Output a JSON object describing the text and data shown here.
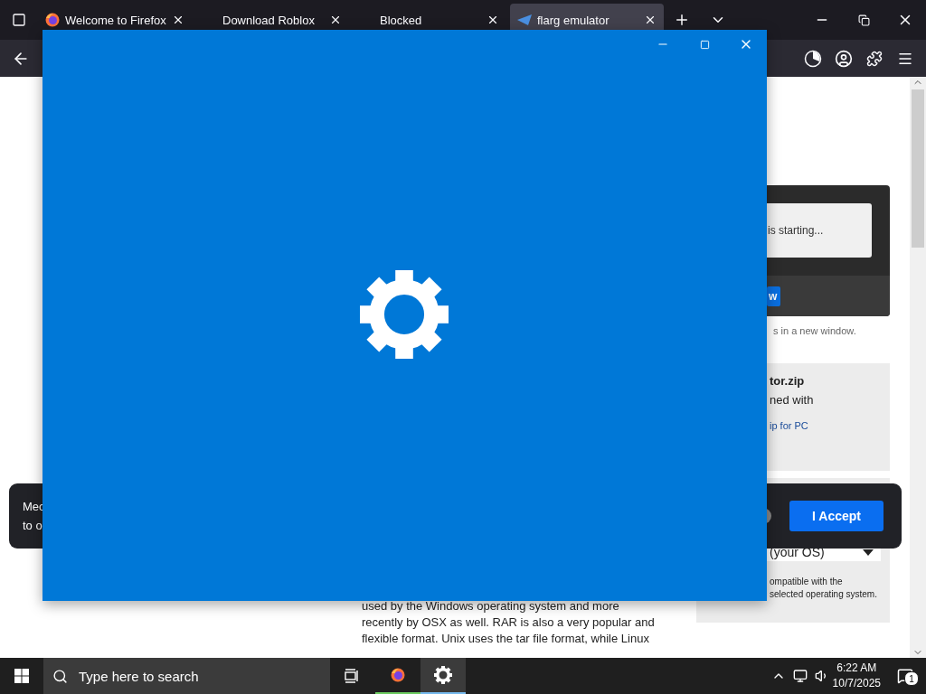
{
  "browser": {
    "tabs": [
      {
        "label": "Welcome to Firefox",
        "kind": "firefox",
        "selected": false
      },
      {
        "label": "Download Roblox",
        "kind": "plain",
        "selected": false
      },
      {
        "label": "Blocked",
        "kind": "plain",
        "selected": false
      },
      {
        "label": "flarg emulator",
        "kind": "app",
        "selected": true
      }
    ]
  },
  "page": {
    "status_text": "is starting...",
    "window_button": "w",
    "window_note": "s in a new window.",
    "file_card": {
      "filename": "tor.zip",
      "opened_with": "ned with",
      "link": "ip for PC"
    },
    "os_select": {
      "value": "(your OS)"
    },
    "compat_note": [
      "ompatible with the",
      "selected operating system."
    ],
    "article_lines": [
      "used by the Windows operating system and more",
      "recently by OSX as well. RAR is also a very popular and",
      "flexible format. Unix uses the tar file format, while Linux"
    ]
  },
  "cookie_banner": {
    "lines": [
      "Mec",
      "to o"
    ],
    "accept_button": "I Accept"
  },
  "taskbar": {
    "search_placeholder": "Type here to search",
    "apps": [
      {
        "kind": "firefox",
        "selected": false
      },
      {
        "kind": "settings",
        "selected": true
      }
    ],
    "time": "6:22 AM",
    "date": "10/7/2025",
    "notifications": "1"
  }
}
